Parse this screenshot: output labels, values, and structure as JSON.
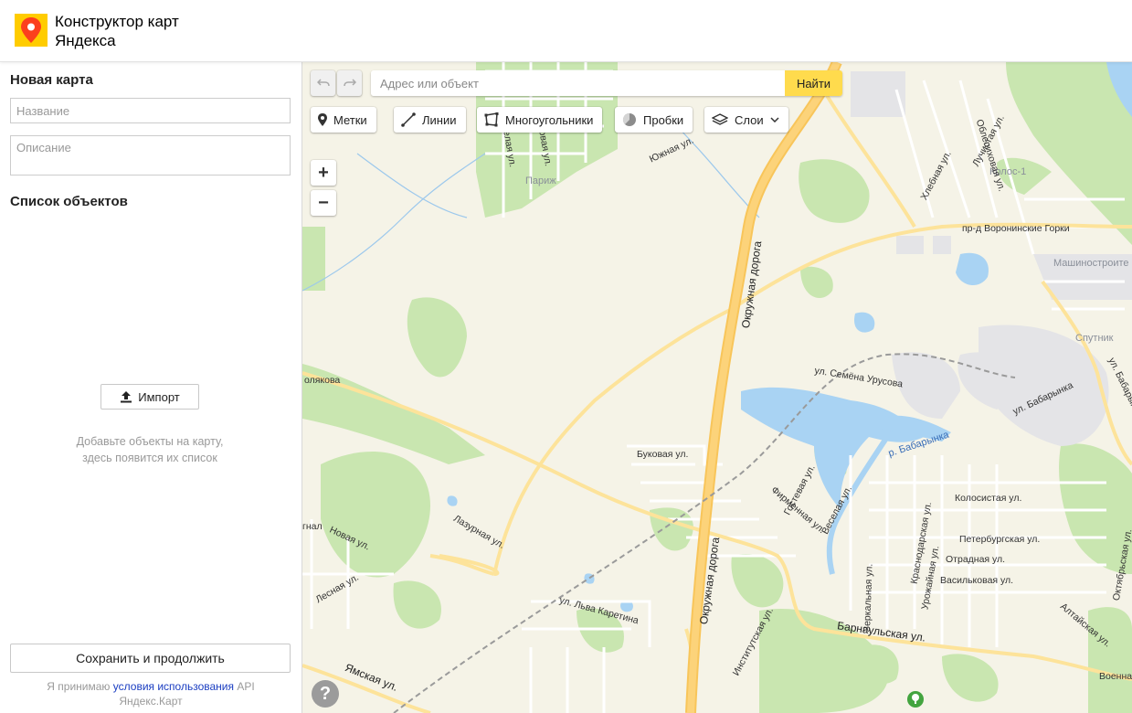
{
  "header": {
    "title": "Конструктор карт\nЯндекса",
    "logo_icon": "yandex-maps-pin-icon",
    "accent": "#fc3f1d"
  },
  "sidebar": {
    "new_map_heading": "Новая карта",
    "name_placeholder": "Название",
    "description_placeholder": "Описание",
    "objects_heading": "Список объектов",
    "import_label": "Импорт",
    "empty_hint": "Добавьте объекты на карту,\nздесь появится их список",
    "save_label": "Сохранить и продолжить",
    "terms_prefix": "Я принимаю ",
    "terms_link": "условия использования",
    "terms_suffix": " API Яндекс.Карт"
  },
  "map": {
    "search_placeholder": "Адрес или объект",
    "search_button": "Найти",
    "search_button_color": "#ffdb4d",
    "tools": {
      "placemarks": "Метки",
      "lines": "Линии",
      "polygons": "Многоугольники",
      "traffic": "Пробки",
      "layers": "Слои"
    },
    "zoom_in": "+",
    "zoom_out": "−",
    "help": "?",
    "labels": {
      "ring_road_1": "Окружная дорога",
      "ring_road_2": "Окружная дорога",
      "voronezh_drive": "пр-д Воронинские Горки",
      "semena_urusova": "ул. Семёна Урусова",
      "babarynka_river": "р. Бабарынка",
      "babarynka_st": "ул. Бабарынка",
      "babarynka_st2": "ул. Бабарынка",
      "bukovaya": "Буковая ул.",
      "gostevaya": "Гостевая ул.",
      "veselaya": "Веселая ул.",
      "firmennaya": "Фирменная ул.",
      "zerkalnaya": "Зеркальная ул.",
      "krasnodarskaya": "Краснодарская ул.",
      "urozhaynaya": "Урожайная ул.",
      "kolosistaya": "Колосистая ул.",
      "peterburgskaya": "Петербургская ул.",
      "otradnaya": "Отрадная ул.",
      "vasilkovaya": "Васильковая ул.",
      "oktyabrskaya": "Октябрьская ул.",
      "barnaulskaya": "Барнаульская ул.",
      "altayskaya": "Алтайская ул.",
      "institutskaya": "Институтская ул.",
      "lva_karetina": "ул. Льва Каретина",
      "lazurnaya": "Лазурная ул.",
      "novaya": "Новая ул.",
      "lesnaya": "Лесная ул.",
      "yamskaya": "Ямская ул.",
      "polyakova": "олякова",
      "voennaya": "Военна",
      "paris": "Париж",
      "kolos": "Колос-1",
      "sputnik": "Спутник",
      "mashinostroitel": "Машиностроите",
      "luchistaya": "Лучистая ул.",
      "khlebnaya": "Хлебная ул.",
      "oblepikhovaya": "Облепиховая ул.",
      "yuzhnaya": "Южная ул.",
      "veselaya_north": "Веселая ул.",
      "bukovaya_north": "Буковая ул.",
      "ignal": "гнал"
    }
  }
}
